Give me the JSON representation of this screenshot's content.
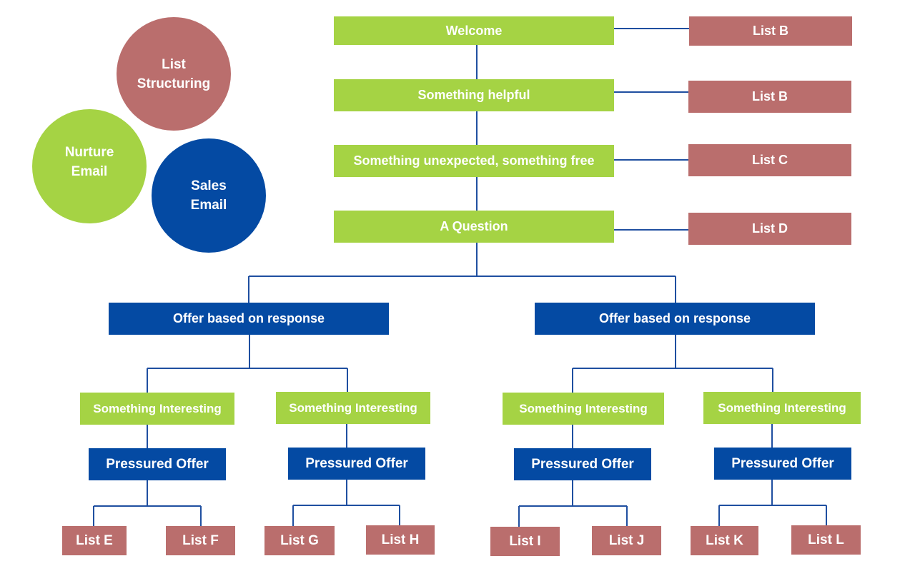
{
  "legend": {
    "items": [
      {
        "id": "list-structuring",
        "lines": [
          "List",
          "Structuring"
        ],
        "color": "#ba6e6d"
      },
      {
        "id": "nurture-email",
        "lines": [
          "Nurture",
          "Email"
        ],
        "color": "#a5d344"
      },
      {
        "id": "sales-email",
        "lines": [
          "Sales",
          "Email"
        ],
        "color": "#044aa3"
      }
    ]
  },
  "colors": {
    "nurture": "#a5d344",
    "sales": "#044aa3",
    "list": "#ba6e6d",
    "connector": "#1f4fa0"
  },
  "sequence": [
    {
      "label": "Welcome",
      "type": "nurture",
      "list": "List B"
    },
    {
      "label": "Something helpful",
      "type": "nurture",
      "list": "List B"
    },
    {
      "label": "Something unexpected, something free",
      "type": "nurture",
      "list": "List C"
    },
    {
      "label": "A Question",
      "type": "nurture",
      "list": "List D"
    }
  ],
  "branches": [
    {
      "label": "Offer based on response",
      "type": "sales",
      "children": [
        {
          "interesting": "Something Interesting",
          "offer": "Pressured Offer",
          "lists": [
            "List E",
            "List F"
          ]
        },
        {
          "interesting": "Something Interesting",
          "offer": "Pressured Offer",
          "lists": [
            "List G",
            "List H"
          ]
        }
      ]
    },
    {
      "label": "Offer based on response",
      "type": "sales",
      "children": [
        {
          "interesting": "Something Interesting",
          "offer": "Pressured Offer",
          "lists": [
            "List I",
            "List J"
          ]
        },
        {
          "interesting": "Something Interesting",
          "offer": "Pressured Offer",
          "lists": [
            "List K",
            "List L"
          ]
        }
      ]
    }
  ]
}
